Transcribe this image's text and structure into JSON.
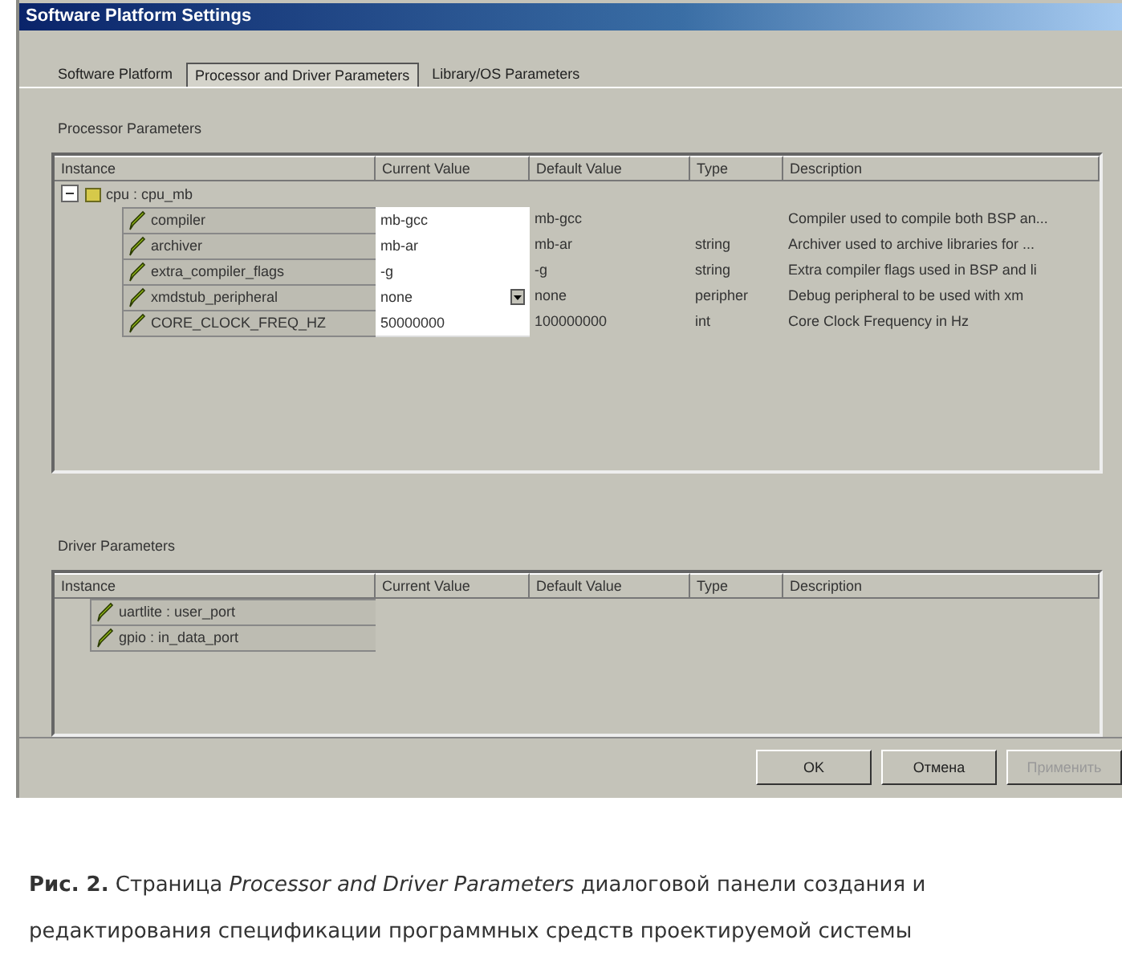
{
  "window": {
    "title": "Software Platform Settings"
  },
  "tabs": [
    {
      "label": "Software Platform",
      "selected": false
    },
    {
      "label": "Processor and Driver Parameters",
      "selected": true
    },
    {
      "label": "Library/OS Parameters",
      "selected": false
    }
  ],
  "processor_parameters": {
    "label": "Processor Parameters",
    "columns": [
      "Instance",
      "Current Value",
      "Default Value",
      "Type",
      "Description"
    ],
    "root": {
      "label": "cpu : cpu_mb",
      "expanded": true,
      "children": [
        {
          "kind": "text",
          "instance": "compiler",
          "current_value": "mb-gcc",
          "default_value": "mb-gcc",
          "description": "Compiler used to compile both BSP an..."
        },
        {
          "kind": "text",
          "instance": "archiver",
          "current_value": "mb-ar",
          "default_value": "mb-ar",
          "type": "string",
          "description": "Archiver used to archive libraries for ..."
        },
        {
          "kind": "text",
          "instance": "extra_compiler_flags",
          "current_value": "-g",
          "default_value": "-g",
          "type": "string",
          "description": "Extra compiler flags used in BSP and li"
        },
        {
          "kind": "dropdown",
          "instance": "xmdstub_peripheral",
          "current_value": "none",
          "default_value": "none",
          "type": "peripher",
          "description": "Debug peripheral to be used with xm"
        },
        {
          "kind": "text",
          "instance": "CORE_CLOCK_FREQ_HZ",
          "current_value": "50000000",
          "default_value": "100000000",
          "type": "int",
          "description": "Core Clock Frequency in Hz"
        }
      ]
    }
  },
  "driver_parameters": {
    "label": "Driver Parameters",
    "columns": [
      "Instance",
      "Current Value",
      "Default Value",
      "Type",
      "Description"
    ],
    "rows": [
      {
        "instance": "uartlite : user_port"
      },
      {
        "instance": "gpio : in_data_port"
      }
    ]
  },
  "buttons": [
    {
      "label": "OK",
      "disabled": false
    },
    {
      "label": "Отмена",
      "disabled": false
    },
    {
      "label": "Применить",
      "disabled": true
    }
  ],
  "caption": "**Рис. 2.** Страница *Processor and Driver Parameters* диалоговой панели создания и редактирования спецификации программных средств проектируемой системы"
}
